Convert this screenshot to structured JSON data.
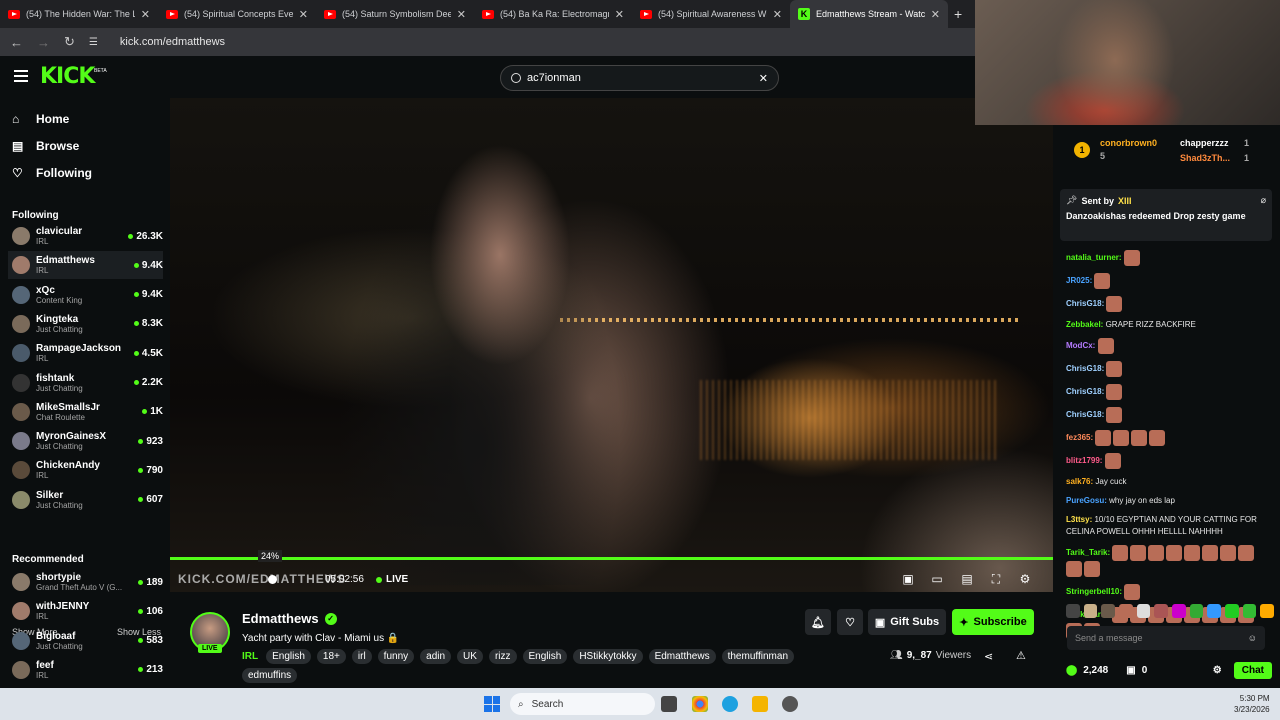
{
  "browser": {
    "tabs": [
      {
        "title": "(54) The Hidden War: The Loosi",
        "type": "youtube"
      },
      {
        "title": "(54) Spiritual Concepts Everyone",
        "type": "youtube"
      },
      {
        "title": "(54) Saturn Symbolism Deep Di",
        "type": "youtube"
      },
      {
        "title": "(54) Ba Ka Ra: Electromagnetic",
        "type": "youtube"
      },
      {
        "title": "(54) Spiritual Awareness Will Ru",
        "type": "youtube"
      },
      {
        "title": "Edmatthews Stream - Watc",
        "type": "kick",
        "active": true
      }
    ],
    "url": "kick.com/edmatthews"
  },
  "header": {
    "logo": "KICK",
    "beta": "BETA",
    "search_value": "ac7ionman"
  },
  "sidebar": {
    "nav": [
      {
        "label": "Home",
        "icon": "home-icon"
      },
      {
        "label": "Browse",
        "icon": "browse-icon"
      },
      {
        "label": "Following",
        "icon": "heart-icon"
      }
    ],
    "following_title": "Following",
    "following": [
      {
        "name": "clavicular",
        "category": "IRL",
        "viewers": "26.3K"
      },
      {
        "name": "Edmatthews",
        "category": "IRL",
        "viewers": "9.4K"
      },
      {
        "name": "xQc",
        "category": "Content King",
        "viewers": "9.4K"
      },
      {
        "name": "Kingteka",
        "category": "Just Chatting",
        "viewers": "8.3K"
      },
      {
        "name": "RampageJackson",
        "category": "IRL",
        "viewers": "4.5K"
      },
      {
        "name": "fishtank",
        "category": "Just Chatting",
        "viewers": "2.2K"
      },
      {
        "name": "MikeSmallsJr",
        "category": "Chat Roulette",
        "viewers": "1K"
      },
      {
        "name": "MyronGainesX",
        "category": "Just Chatting",
        "viewers": "923"
      },
      {
        "name": "ChickenAndy",
        "category": "IRL",
        "viewers": "790"
      },
      {
        "name": "Silker",
        "category": "Just Chatting",
        "viewers": "607"
      }
    ],
    "show_more": "Show More",
    "show_less": "Show Less",
    "recommended_title": "Recommended",
    "recommended": [
      {
        "name": "shortypie",
        "category": "Grand Theft Auto V (G...",
        "viewers": "189"
      },
      {
        "name": "withJENNY",
        "category": "IRL",
        "viewers": "106"
      },
      {
        "name": "Bigloaaf",
        "category": "Just Chatting",
        "viewers": "583"
      },
      {
        "name": "feef",
        "category": "IRL",
        "viewers": "213"
      }
    ]
  },
  "player": {
    "hover_percent": "24%",
    "watermark": "KICK.COM/EDMATTHEWS",
    "timecode": "05:02:56",
    "live": "LIVE",
    "progress": 1.0
  },
  "stream": {
    "streamer": "Edmatthews",
    "live_badge": "LIVE",
    "title": "Yacht party with Clav - Miami us 🔒",
    "category": "IRL",
    "tags": [
      "English",
      "18+",
      "irl",
      "funny",
      "adin",
      "UK",
      "rizz",
      "English",
      "HStikkytokky",
      "Edmatthews",
      "themuffinman",
      "edmuffins"
    ],
    "gift_subs": "Gift Subs",
    "subscribe": "Subscribe",
    "viewers_count": "9,_87",
    "viewers_label": "Viewers"
  },
  "chat": {
    "top": [
      {
        "rank": "1",
        "name": "conorbrown0",
        "count": "5"
      },
      {
        "name": "chapperzzz",
        "count": "1"
      },
      {
        "name": "Shad3zTh...",
        "count": "1"
      }
    ],
    "pinned_sent_by": "Sent by",
    "pinned_user": "XIII",
    "pinned_text": "Danzoakishas redeemed Drop zesty game",
    "messages": [
      {
        "user": "natalia_turner:",
        "text": "",
        "emotes": 1,
        "color": "#53fc18"
      },
      {
        "user": "JR025:",
        "text": "",
        "emotes": 1,
        "color": "#4aa3ff"
      },
      {
        "user": "ChrisG18:",
        "text": "",
        "emotes": 1,
        "color": "#9fd0ff"
      },
      {
        "user": "Zebbakel:",
        "text": "GRAPE RIZZ BACKFIRE",
        "emotes": 0,
        "color": "#53fc18"
      },
      {
        "user": "ModCx:",
        "text": "",
        "emotes": 1,
        "color": "#b57bff"
      },
      {
        "user": "ChrisG18:",
        "text": "",
        "emotes": 1,
        "color": "#9fd0ff"
      },
      {
        "user": "ChrisG18:",
        "text": "",
        "emotes": 1,
        "color": "#9fd0ff"
      },
      {
        "user": "ChrisG18:",
        "text": "",
        "emotes": 1,
        "color": "#9fd0ff"
      },
      {
        "user": "fez365:",
        "text": "",
        "emotes": 4,
        "color": "#ff8a5b"
      },
      {
        "user": "blitz1799:",
        "text": "",
        "emotes": 1,
        "color": "#ff5b8a"
      },
      {
        "user": "salk76:",
        "text": "Jay cuck",
        "emotes": 0,
        "color": "#ffb020"
      },
      {
        "user": "PureGosu:",
        "text": "why jay on eds lap",
        "emotes": 0,
        "color": "#4aa3ff"
      },
      {
        "user": "L3ttsy:",
        "text": "10/10 EGYPTIAN AND YOUR CATTING FOR CELINA POWELL OHHH HELLLL NAHHHH",
        "emotes": 0,
        "color": "#ffe24a"
      },
      {
        "user": "Tarik_Tarik:",
        "text": "",
        "emotes": 10,
        "color": "#53fc18"
      },
      {
        "user": "Stringerbell10:",
        "text": "",
        "emotes": 1,
        "color": "#53fc18"
      },
      {
        "user": "Tarik_Tarik:",
        "text": "",
        "emotes": 10,
        "color": "#53fc18"
      }
    ],
    "input_placeholder": "Send a message",
    "points": "2,248",
    "gifts": "0",
    "send_label": "Chat"
  },
  "taskbar": {
    "search": "Search",
    "time": "5:30 PM",
    "date": "3/23/2026"
  },
  "colors": {
    "accent": "#53fc18",
    "background": "#0b0e0f"
  }
}
